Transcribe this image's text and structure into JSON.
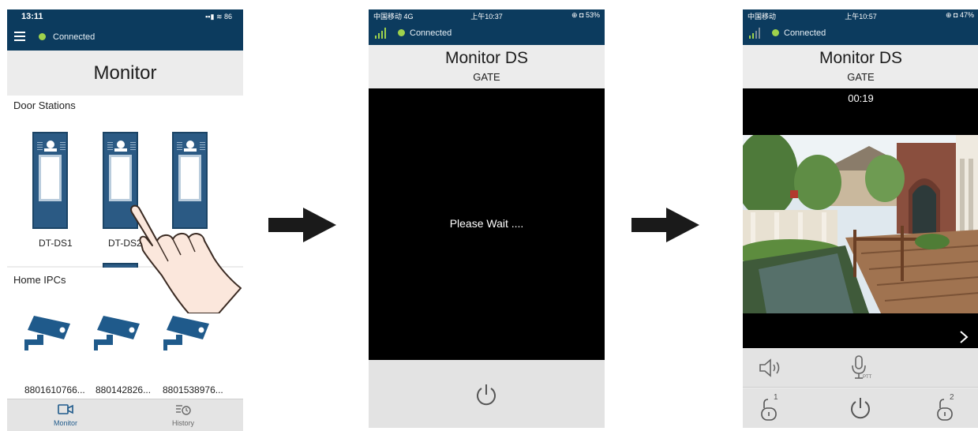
{
  "colors": {
    "header": "#0c3b5e",
    "accent": "#1f5a8b",
    "connected": "#9fd24c"
  },
  "phone1": {
    "status_time": "13:11",
    "status_icons": "▪▪▮ ≋ 86",
    "connection": "Connected",
    "title": "Monitor",
    "door_section": "Door Stations",
    "door_stations": [
      "DT-DS1",
      "DT-DS2"
    ],
    "ipc_section": "Home IPCs",
    "ipcs": [
      "8801610766...",
      "880142826...",
      "8801538976..."
    ],
    "tabs": [
      {
        "label": "Monitor",
        "icon": "camera-icon"
      },
      {
        "label": "History",
        "icon": "history-icon"
      }
    ]
  },
  "phone2": {
    "status_left": "中国移动 4G",
    "status_time": "上午10:37",
    "status_right": "⊕ ◘ 53%",
    "connection": "Connected",
    "title": "Monitor DS",
    "subtitle": "GATE",
    "wait": "Please Wait ...."
  },
  "phone3": {
    "status_left": "中国移动",
    "status_time": "上午10:57",
    "status_right": "⊕ ◘ 47%",
    "connection": "Connected",
    "title": "Monitor DS",
    "subtitle": "GATE",
    "timer": "00:19",
    "unlock1": "1",
    "unlock2": "2",
    "ptt": "PTT"
  }
}
